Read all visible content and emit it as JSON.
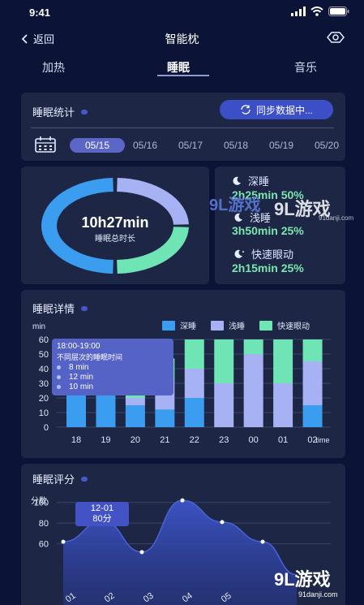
{
  "status": {
    "time": "9:41"
  },
  "nav": {
    "back_label": "返回",
    "title": "智能枕"
  },
  "tabs": [
    {
      "label": "加热",
      "active": false
    },
    {
      "label": "睡眠",
      "active": true
    },
    {
      "label": "音乐",
      "active": false
    }
  ],
  "stats_card": {
    "title": "睡眠统计",
    "sync_label": "同步数据中...",
    "dates": [
      "05/15",
      "05/16",
      "05/17",
      "05/18",
      "05/19",
      "05/20"
    ],
    "selected_date": "05/15"
  },
  "summary": {
    "total_time": "10h27min",
    "total_label": "睡眠总时长",
    "items": [
      {
        "label": "深睡",
        "value": "2h25min 50%"
      },
      {
        "label": "浅睡",
        "value": "3h50min 25%"
      },
      {
        "label": "快速眼动",
        "value": "2h15min 25%"
      }
    ]
  },
  "detail_card": {
    "title": "睡眠详情",
    "tooltip": {
      "time_range": "18:00-19:00",
      "subtitle": "不同层次的睡眠时间",
      "rows": [
        "8  min",
        "12  min",
        "10  min"
      ]
    }
  },
  "score_card": {
    "title": "睡眠评分",
    "tooltip_date": "12-01",
    "tooltip_score": "80分"
  },
  "colors": {
    "deep": "#3a9df0",
    "light": "#a7b2f5",
    "rem": "#6fe5b5",
    "background": "#0b1436",
    "card": "#1d2745",
    "accent": "#3c4fc7"
  },
  "watermark": {
    "brand": "9L游戏",
    "site": "91danji.com"
  },
  "chart_data": [
    {
      "type": "pie",
      "donut": true,
      "slices": [
        {
          "label": "深睡",
          "value": 50,
          "color": "#3a9df0"
        },
        {
          "label": "浅睡",
          "value": 25,
          "color": "#a7b2f5"
        },
        {
          "label": "快速眼动",
          "value": 25,
          "color": "#6fe5b5"
        }
      ]
    },
    {
      "type": "bar",
      "stacked": true,
      "ylabel": "min",
      "xlabel": "time",
      "ylim": [
        0,
        60
      ],
      "yticks": [
        0,
        10,
        20,
        30,
        40,
        50,
        60
      ],
      "categories": [
        "18",
        "19",
        "20",
        "21",
        "22",
        "23",
        "00",
        "01",
        "02"
      ],
      "legend_placement": "top-right",
      "series": [
        {
          "name": "深睡",
          "color": "#3a9df0",
          "values": [
            40,
            25,
            15,
            12,
            20,
            0,
            0,
            0,
            15
          ]
        },
        {
          "name": "浅睡",
          "color": "#a7b2f5",
          "values": [
            10,
            12,
            5,
            20,
            20,
            30,
            50,
            30,
            30
          ]
        },
        {
          "name": "快速眼动",
          "color": "#6fe5b5",
          "values": [
            10,
            10,
            10,
            15,
            20,
            30,
            10,
            30,
            15
          ]
        }
      ]
    },
    {
      "type": "area",
      "ylabel": "分数",
      "ylim": [
        0,
        110
      ],
      "yticks": [
        60,
        80,
        100
      ],
      "x_labels": [
        "01",
        "02",
        "03",
        "04",
        "05"
      ],
      "values": [
        62,
        82,
        52,
        102,
        81,
        62,
        30
      ]
    }
  ]
}
